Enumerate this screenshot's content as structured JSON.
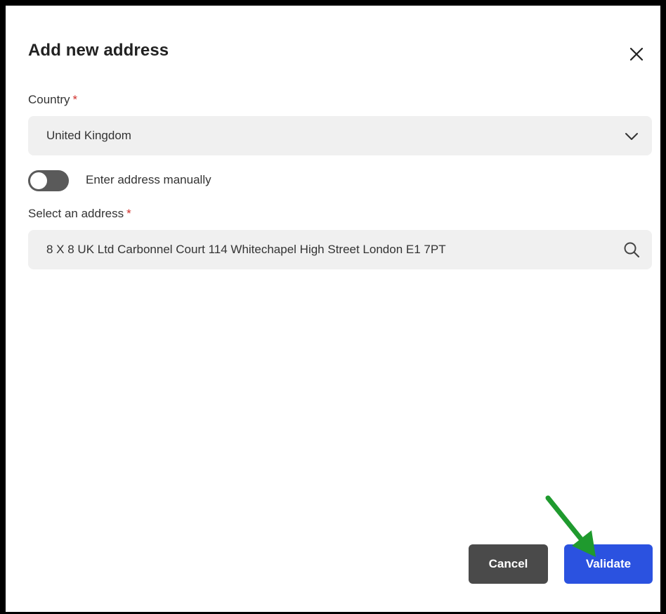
{
  "dialog": {
    "title": "Add new address",
    "close_icon": "close-icon"
  },
  "country": {
    "label": "Country",
    "required_mark": "*",
    "value": "United Kingdom",
    "dropdown_icon": "chevron-down-icon"
  },
  "manual_toggle": {
    "label": "Enter address manually",
    "state": "off"
  },
  "address": {
    "label": "Select an address",
    "required_mark": "*",
    "value": "8 X 8 UK Ltd Carbonnel Court 114 Whitechapel High Street London E1 7PT",
    "search_icon": "search-icon"
  },
  "actions": {
    "cancel_label": "Cancel",
    "validate_label": "Validate"
  },
  "annotation": {
    "arrow_icon": "arrow-icon",
    "arrow_color": "#1f9a2e"
  },
  "colors": {
    "primary": "#2b52e0",
    "secondary_button": "#4a4a4a",
    "required": "#d0312d"
  }
}
